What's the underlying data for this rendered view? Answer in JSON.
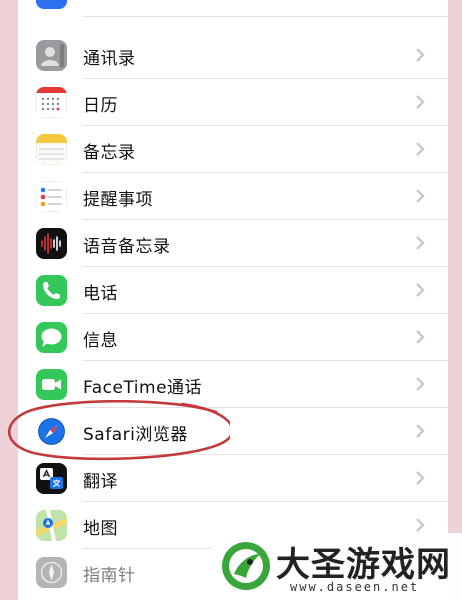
{
  "settings_list": {
    "items": [
      {
        "label": "通讯录",
        "icon": "contacts-icon"
      },
      {
        "label": "日历",
        "icon": "calendar-icon"
      },
      {
        "label": "备忘录",
        "icon": "notes-icon"
      },
      {
        "label": "提醒事项",
        "icon": "reminders-icon"
      },
      {
        "label": "语音备忘录",
        "icon": "voice-memos-icon"
      },
      {
        "label": "电话",
        "icon": "phone-icon"
      },
      {
        "label": "信息",
        "icon": "messages-icon"
      },
      {
        "label": "FaceTime通话",
        "icon": "facetime-icon"
      },
      {
        "label": "Safari浏览器",
        "icon": "safari-icon"
      },
      {
        "label": "翻译",
        "icon": "translate-icon"
      },
      {
        "label": "地图",
        "icon": "maps-icon"
      },
      {
        "label": "指南针",
        "icon": "compass-icon"
      }
    ]
  },
  "watermark": {
    "title": "大圣游戏网",
    "url": "www.daseen.net"
  },
  "colors": {
    "background": "#efd2d8",
    "annotation_circle": "#c23a3a",
    "chevron": "#c4c4c8",
    "separator": "#e3e3e6",
    "phone_green": "#34c759",
    "safari_blue": "#1a73e8"
  }
}
